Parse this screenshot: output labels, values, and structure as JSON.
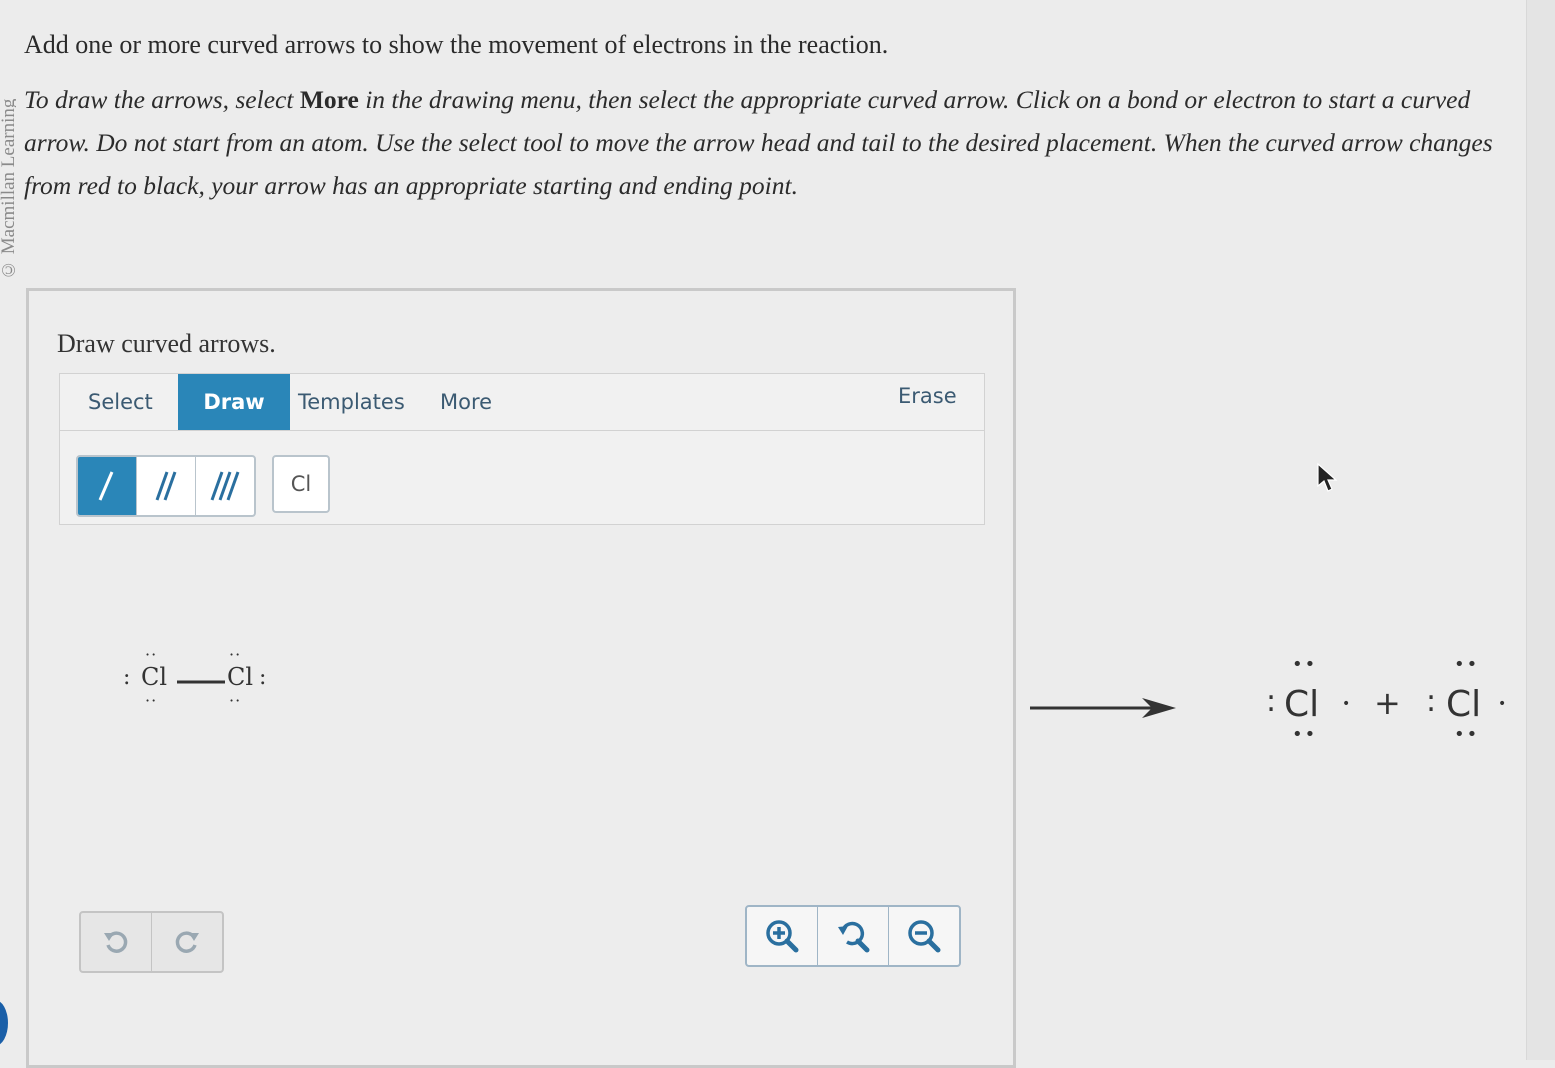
{
  "side_credit": "© Macmillan Learning",
  "question": "Add one or more curved arrows to show the movement of electrons in the reaction.",
  "instructions": {
    "p1": "To draw the arrows, select ",
    "bold": "More",
    "p2": " in the drawing menu, then select the appropriate curved arrow. Click on a bond or electron to start a curved arrow. Do not start from an atom. Use the select tool to move the arrow head and tail to the desired placement. When the curved arrow changes from red to black, your arrow has an appropriate starting and ending point."
  },
  "panel": {
    "title": "Draw curved arrows.",
    "tabs": [
      {
        "label": "Select",
        "active": false
      },
      {
        "label": "Draw",
        "active": true
      },
      {
        "label": "Templates",
        "active": false
      },
      {
        "label": "More",
        "active": false
      }
    ],
    "erase_label": "Erase",
    "bond_tools": [
      "single-bond",
      "double-bond",
      "triple-bond"
    ],
    "active_bond": "single-bond",
    "atom_button": "Cl"
  },
  "reactant": {
    "left_atom": "Cl",
    "right_atom": "Cl",
    "lone_pair": ":",
    "dots": "··"
  },
  "products": {
    "atom1": "Cl",
    "atom2": "Cl",
    "plus": "+",
    "lone_pair": ":",
    "dots": "••",
    "radical": "•"
  },
  "colors": {
    "accent": "#2a86b8",
    "tab_text": "#3b5a72",
    "zoom_icon": "#2a6f9f"
  },
  "icons": [
    "undo-icon",
    "redo-icon",
    "zoom-in-icon",
    "zoom-reset-icon",
    "zoom-out-icon",
    "cursor-icon",
    "reaction-arrow-icon"
  ]
}
